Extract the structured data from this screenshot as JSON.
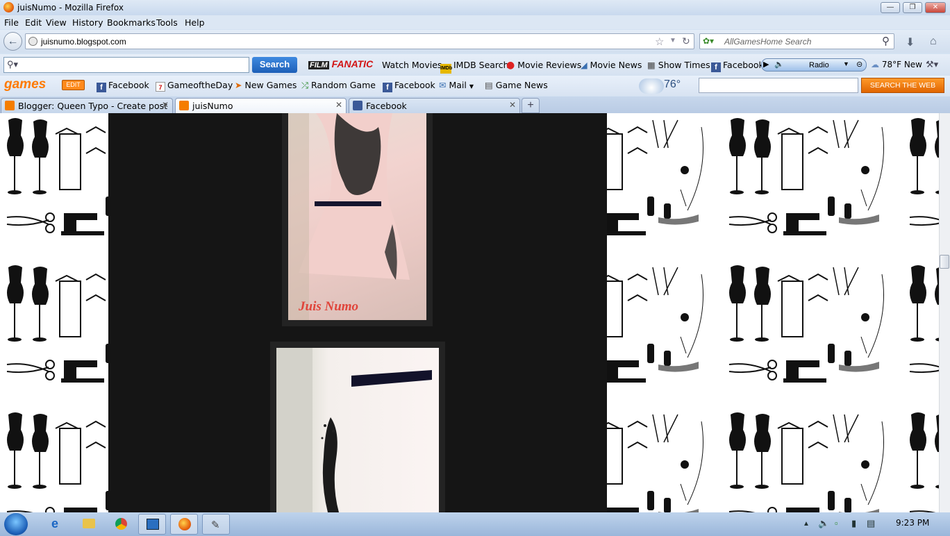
{
  "window": {
    "title": "juisNumo - Mozilla Firefox"
  },
  "menu": [
    "File",
    "Edit",
    "View",
    "History",
    "Bookmarks",
    "Tools",
    "Help"
  ],
  "nav": {
    "url": "juisnumo.blogspot.com",
    "search_placeholder": "AllGamesHome Search"
  },
  "toolbar1": {
    "search_label": "Search",
    "brand": "FANATIC",
    "links": [
      "Watch Movies",
      "IMDB Search",
      "Movie Reviews",
      "Movie News",
      "Show Times",
      "Facebook"
    ],
    "radio": "Radio",
    "weather": "78°F New"
  },
  "toolbar2": {
    "brand": "games",
    "edit": "EDIT",
    "links": [
      "Facebook",
      "GameoftheDay",
      "New Games",
      "Random Game",
      "Facebook",
      "Mail",
      "Game News"
    ],
    "temperature": "76°",
    "search_web": "SEARCH THE WEB"
  },
  "tabs": [
    {
      "label": "Blogger: Queen Typo - Create post",
      "icon_color": "#f57d00"
    },
    {
      "label": "juisNumo",
      "icon_color": "#f57d00"
    },
    {
      "label": "Facebook",
      "icon_color": "#3b5998"
    }
  ],
  "content": {
    "watermark": "Juis Numo"
  },
  "taskbar": {
    "clock": "9:23 PM"
  }
}
